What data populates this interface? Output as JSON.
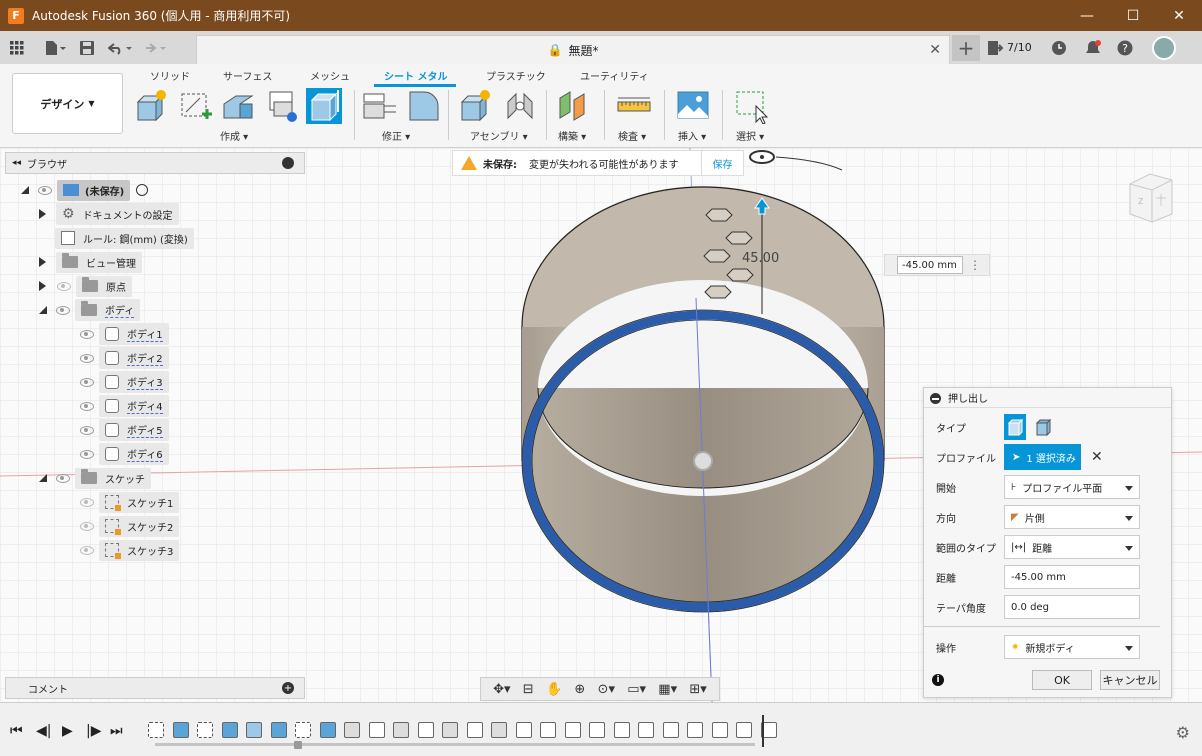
{
  "titlebar": {
    "app_icon": "F",
    "title": "Autodesk Fusion 360 (個人用 - 商用利用不可)",
    "minimize": "—",
    "maximize": "☐",
    "close": "✕"
  },
  "appbar": {
    "doc_name": "無題*",
    "jobs": "7/10"
  },
  "toolbar": {
    "workspace": "デザイン",
    "tabs": [
      "ソリッド",
      "サーフェス",
      "メッシュ",
      "シート メタル",
      "プラスチック",
      "ユーティリティ"
    ],
    "active_tab": "シート メタル",
    "groups": [
      "作成",
      "修正",
      "アセンブリ",
      "構築",
      "検査",
      "挿入",
      "選択"
    ]
  },
  "browser": {
    "title": "ブラウザ",
    "root": "(未保存)",
    "doc_settings": "ドキュメントの設定",
    "rule": "ルール: 鋼(mm) (変換)",
    "view_mgmt": "ビュー管理",
    "origin": "原点",
    "bodies": "ボディ",
    "body_items": [
      "ボディ1",
      "ボディ2",
      "ボディ3",
      "ボディ4",
      "ボディ5",
      "ボディ6"
    ],
    "sketches": "スケッチ",
    "sketch_items": [
      "スケッチ1",
      "スケッチ2",
      "スケッチ3"
    ]
  },
  "comments": {
    "label": "コメント"
  },
  "unsaved": {
    "title": "未保存:",
    "message": "変更が失われる可能性があります",
    "save": "保存"
  },
  "dimension": {
    "canvas_label": "45.00",
    "input_value": "-45.00 mm"
  },
  "extrude": {
    "title": "押し出し",
    "type_label": "タイプ",
    "profile_label": "プロファイル",
    "profile_value": "1 選択済み",
    "start_label": "開始",
    "start_value": "プロファイル平面",
    "direction_label": "方向",
    "direction_value": "片側",
    "extent_label": "範囲のタイプ",
    "extent_value": "距離",
    "distance_label": "距離",
    "distance_value": "-45.00 mm",
    "taper_label": "テーパ角度",
    "taper_value": "0.0 deg",
    "operation_label": "操作",
    "operation_value": "新規ボディ",
    "ok": "OK",
    "cancel": "キャンセル"
  },
  "colors": {
    "titlebar": "#7a4a1e",
    "accent": "#0696d7",
    "ring": "#2a5caa",
    "body": "#c9c0b4"
  }
}
